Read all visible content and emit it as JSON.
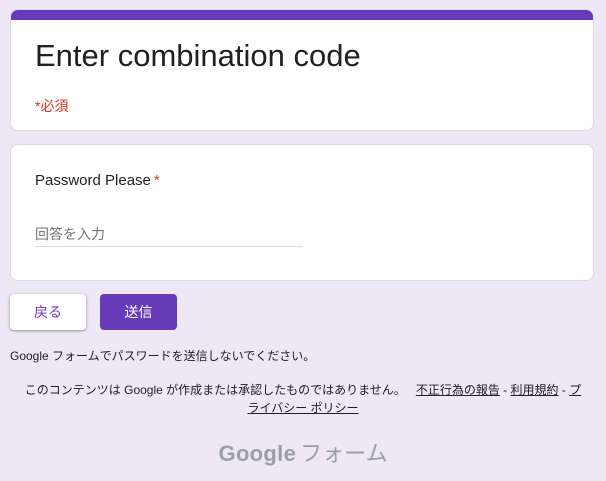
{
  "form": {
    "title": "Enter combination code",
    "required_note": "*必須",
    "accent_color": "#673ab7",
    "background_color": "#ede7f6"
  },
  "question": {
    "label": "Password Please",
    "required_star": "*",
    "placeholder": "回答を入力",
    "value": ""
  },
  "buttons": {
    "back_label": "戻る",
    "submit_label": "送信"
  },
  "footer": {
    "password_warning": "Google フォームでパスワードを送信しないでください。",
    "disclaimer": "このコンテンツは Google が作成または承認したものではありません。",
    "report_abuse_link": "不正行為の報告",
    "separator": " - ",
    "terms_link": "利用規約",
    "privacy_link_part1": "プ",
    "privacy_link_part2": "ライバシー ポリシー",
    "brand_google": "Google",
    "brand_forms": "フォーム"
  }
}
